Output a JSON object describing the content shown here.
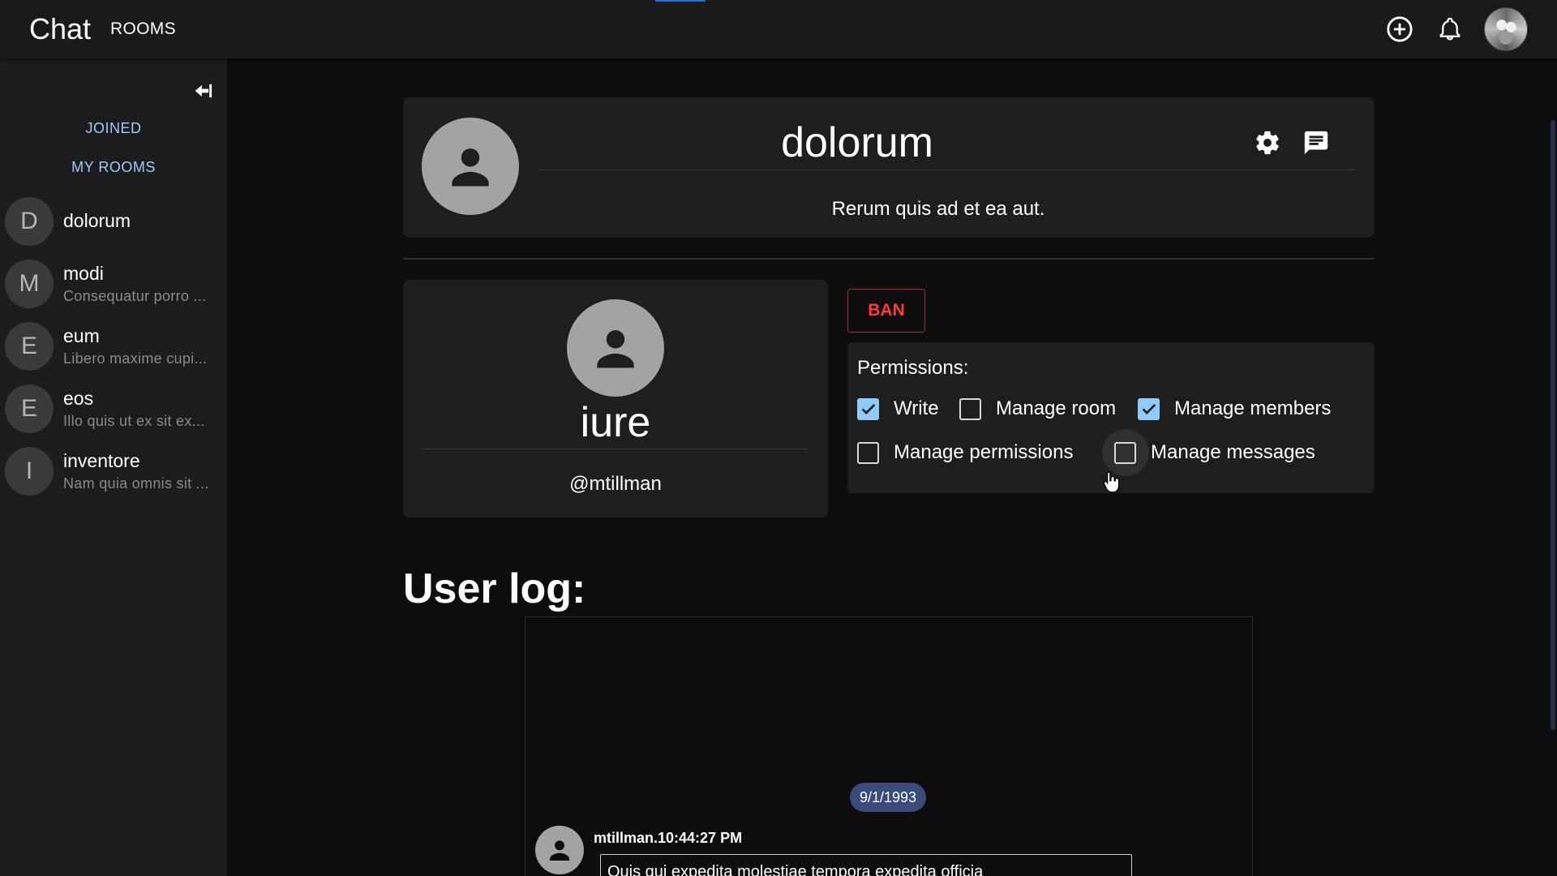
{
  "appbar": {
    "brand": "Chat",
    "rooms_link": "ROOMS",
    "icons": [
      "add-circle-icon",
      "bell-icon",
      "user-avatar"
    ]
  },
  "sidebar": {
    "tabs": [
      "JOINED",
      "MY ROOMS"
    ],
    "rooms": [
      {
        "initial": "D",
        "name": "dolorum",
        "preview": ""
      },
      {
        "initial": "M",
        "name": "modi",
        "preview": "Consequatur porro ..."
      },
      {
        "initial": "E",
        "name": "eum",
        "preview": "Libero maxime cupi..."
      },
      {
        "initial": "E",
        "name": "eos",
        "preview": "Illo quis ut ex sit ex..."
      },
      {
        "initial": "I",
        "name": "inventore",
        "preview": "Nam quia omnis sit ..."
      }
    ]
  },
  "room": {
    "title": "dolorum",
    "description": "Rerum quis ad et ea aut."
  },
  "member": {
    "name": "iure",
    "handle": "@mtillman",
    "ban_label": "BAN",
    "permissions_title": "Permissions:",
    "permissions": [
      {
        "label": "Write",
        "checked": true
      },
      {
        "label": "Manage room",
        "checked": false
      },
      {
        "label": "Manage members",
        "checked": true
      },
      {
        "label": "Manage permissions",
        "checked": false
      },
      {
        "label": "Manage messages",
        "checked": false
      }
    ]
  },
  "log": {
    "title": "User log:",
    "date_chip": "9/1/1993",
    "message_meta": "mtillman.10:44:27 PM",
    "message_text": "Quis qui expedita molestiae tempora expedita officia"
  },
  "colors": {
    "accent": "#90caf9",
    "danger": "#ff3b3b",
    "link": "#9ecbff",
    "surface": "#1e1e1e",
    "background": "#0d0d0d"
  }
}
